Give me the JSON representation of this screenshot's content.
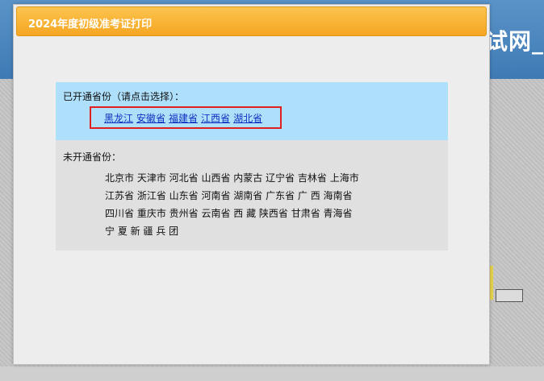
{
  "background": {
    "header_text": "试网_"
  },
  "dialog": {
    "title": "2024年度初级准考证打印",
    "open_section": {
      "label": "已开通省份（请点击选择）：",
      "provinces": [
        "黑龙江",
        "安徽省",
        "福建省",
        "江西省",
        "湖北省"
      ]
    },
    "closed_section": {
      "label": "未开通省份：",
      "lines": [
        "北京市 天津市 河北省 山西省 内蒙古 辽宁省 吉林省 上海市",
        "江苏省 浙江省 山东省 河南省 湖南省 广东省 广 西 海南省",
        "四川省 重庆市 贵州省 云南省 西 藏 陕西省 甘肃省 青海省",
        "宁 夏 新 疆 兵 团"
      ]
    }
  },
  "colors": {
    "title_bar": "#f5a623",
    "open_panel": "#aee0fb",
    "closed_panel": "#e0e0e0",
    "highlight_border": "#e02020",
    "link": "#1030c0"
  }
}
